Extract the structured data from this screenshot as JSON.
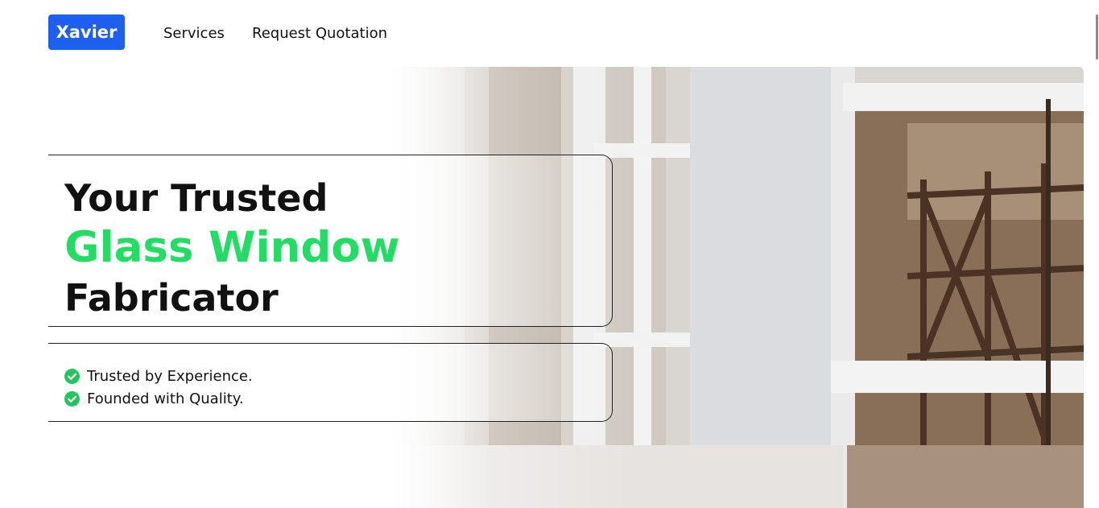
{
  "nav": {
    "brand": "Xavier",
    "links": [
      {
        "label": "Services"
      },
      {
        "label": "Request Quotation"
      }
    ]
  },
  "hero": {
    "headline_line1": "Your Trusted",
    "headline_line2": "Glass Window",
    "headline_line3": "Fabricator",
    "features": [
      {
        "text": "Trusted by Experience.",
        "icon": "check-circle-icon"
      },
      {
        "text": "Founded with Quality.",
        "icon": "check-circle-icon"
      }
    ]
  },
  "colors": {
    "brand": "#1f5fef",
    "accent_green": "#22dc64",
    "text": "#111111"
  }
}
